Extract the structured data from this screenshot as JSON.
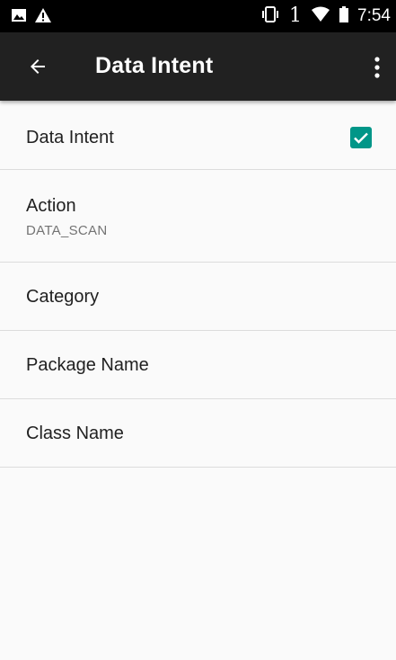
{
  "status_bar": {
    "time": "7:54",
    "sim_slot": "1",
    "icons": [
      "image-icon",
      "warning-icon",
      "vibrate-icon",
      "wifi-icon",
      "battery-icon"
    ]
  },
  "toolbar": {
    "title": "Data Intent",
    "back_icon": "arrow-left-icon",
    "menu_icon": "more-vertical-icon"
  },
  "colors": {
    "status_bar": "#000000",
    "toolbar": "#212121",
    "accent": "#009688",
    "background": "#fafafa",
    "divider": "#dcdcdc"
  },
  "settings": {
    "data_intent": {
      "label": "Data Intent",
      "checked": true
    },
    "action": {
      "label": "Action",
      "summary": "DATA_SCAN"
    },
    "category": {
      "label": "Category"
    },
    "package_name": {
      "label": "Package Name"
    },
    "class_name": {
      "label": "Class Name"
    }
  }
}
